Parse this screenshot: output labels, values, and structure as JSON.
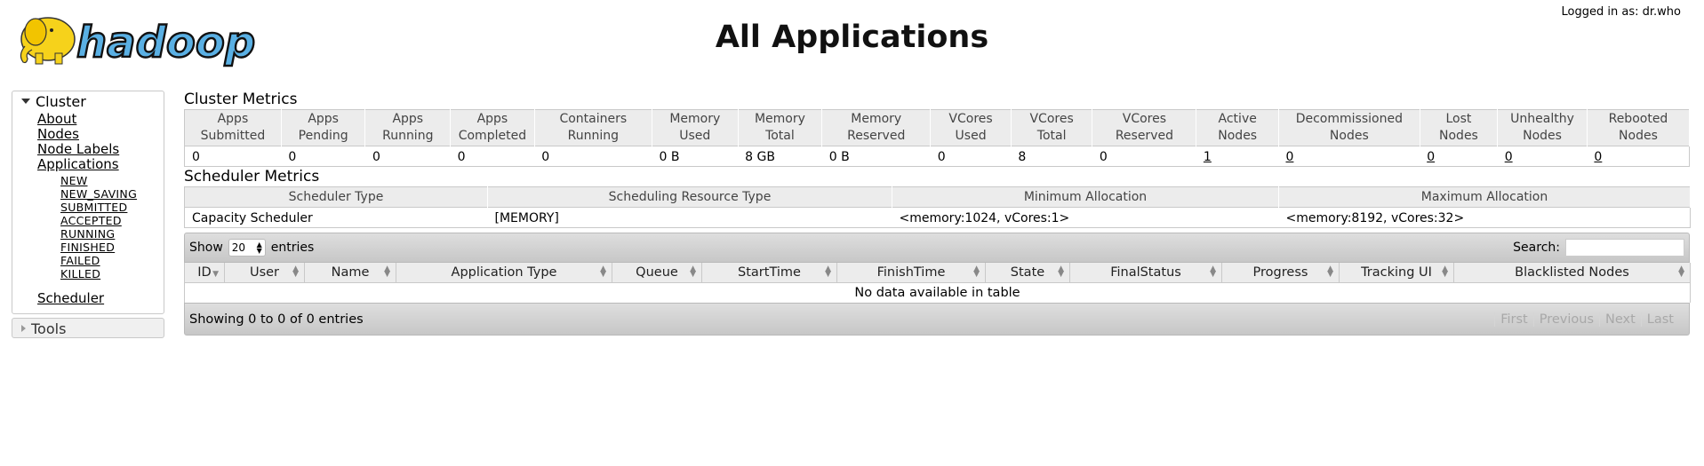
{
  "header": {
    "title": "All Applications",
    "logged_in": "Logged in as: dr.who",
    "logo_text": "hadoop"
  },
  "sidebar": {
    "cluster_label": "Cluster",
    "items": [
      "About",
      "Nodes",
      "Node Labels",
      "Applications"
    ],
    "app_states": [
      "NEW",
      "NEW_SAVING",
      "SUBMITTED",
      "ACCEPTED",
      "RUNNING",
      "FINISHED",
      "FAILED",
      "KILLED"
    ],
    "scheduler": "Scheduler",
    "tools_label": "Tools"
  },
  "cluster_metrics": {
    "title": "Cluster Metrics",
    "headers": [
      [
        "Apps",
        "Submitted"
      ],
      [
        "Apps",
        "Pending"
      ],
      [
        "Apps",
        "Running"
      ],
      [
        "Apps",
        "Completed"
      ],
      [
        "Containers",
        "Running"
      ],
      [
        "Memory",
        "Used"
      ],
      [
        "Memory",
        "Total"
      ],
      [
        "Memory",
        "Reserved"
      ],
      [
        "VCores",
        "Used"
      ],
      [
        "VCores",
        "Total"
      ],
      [
        "VCores",
        "Reserved"
      ],
      [
        "Active",
        "Nodes"
      ],
      [
        "Decommissioned",
        "Nodes"
      ],
      [
        "Lost",
        "Nodes"
      ],
      [
        "Unhealthy",
        "Nodes"
      ],
      [
        "Rebooted",
        "Nodes"
      ]
    ],
    "values": [
      "0",
      "0",
      "0",
      "0",
      "0",
      "0 B",
      "8 GB",
      "0 B",
      "0",
      "8",
      "0",
      "1",
      "0",
      "0",
      "0",
      "0"
    ]
  },
  "scheduler_metrics": {
    "title": "Scheduler Metrics",
    "headers": [
      "Scheduler Type",
      "Scheduling Resource Type",
      "Minimum Allocation",
      "Maximum Allocation"
    ],
    "values": [
      "Capacity Scheduler",
      "[MEMORY]",
      "<memory:1024, vCores:1>",
      "<memory:8192, vCores:32>"
    ]
  },
  "apps_table": {
    "show_label": "Show",
    "page_size": "20",
    "entries_label": "entries",
    "search_label": "Search:",
    "search_value": "",
    "columns": [
      "ID",
      "User",
      "Name",
      "Application Type",
      "Queue",
      "StartTime",
      "FinishTime",
      "State",
      "FinalStatus",
      "Progress",
      "Tracking UI",
      "Blacklisted Nodes"
    ],
    "empty_message": "No data available in table",
    "info": "Showing 0 to 0 of 0 entries",
    "pager": [
      "First",
      "Previous",
      "Next",
      "Last"
    ]
  }
}
